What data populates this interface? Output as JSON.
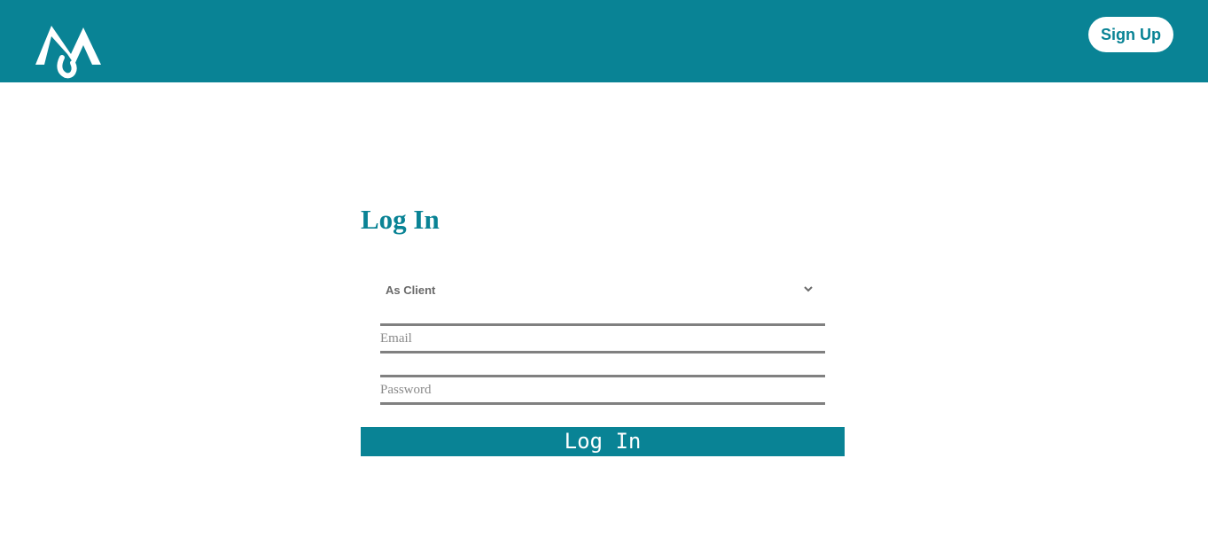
{
  "header": {
    "logo_icon": "mountain-m-logo-icon",
    "signup_label": "Sign Up",
    "background": "#098395"
  },
  "login": {
    "title": "Log In",
    "role_select": {
      "selected": "As Client",
      "options": [
        "As Client"
      ]
    },
    "email_placeholder": "Email",
    "password_placeholder": "Password",
    "submit_label": "Log In"
  },
  "colors": {
    "accent": "#098395",
    "field_border": "#808080"
  }
}
